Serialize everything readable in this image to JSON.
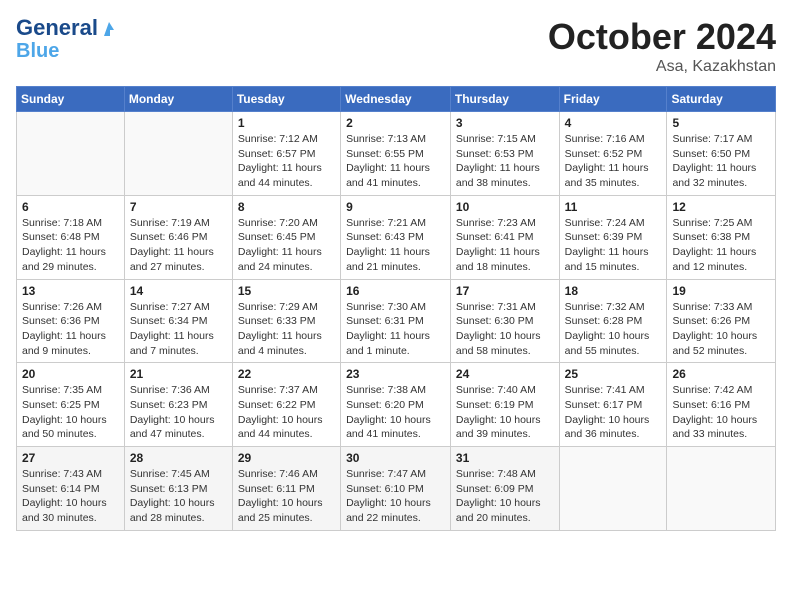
{
  "header": {
    "logo_line1": "General",
    "logo_line2": "Blue",
    "month": "October 2024",
    "location": "Asa, Kazakhstan"
  },
  "weekdays": [
    "Sunday",
    "Monday",
    "Tuesday",
    "Wednesday",
    "Thursday",
    "Friday",
    "Saturday"
  ],
  "weeks": [
    [
      {
        "day": "",
        "sunrise": "",
        "sunset": "",
        "daylight": ""
      },
      {
        "day": "",
        "sunrise": "",
        "sunset": "",
        "daylight": ""
      },
      {
        "day": "1",
        "sunrise": "Sunrise: 7:12 AM",
        "sunset": "Sunset: 6:57 PM",
        "daylight": "Daylight: 11 hours and 44 minutes."
      },
      {
        "day": "2",
        "sunrise": "Sunrise: 7:13 AM",
        "sunset": "Sunset: 6:55 PM",
        "daylight": "Daylight: 11 hours and 41 minutes."
      },
      {
        "day": "3",
        "sunrise": "Sunrise: 7:15 AM",
        "sunset": "Sunset: 6:53 PM",
        "daylight": "Daylight: 11 hours and 38 minutes."
      },
      {
        "day": "4",
        "sunrise": "Sunrise: 7:16 AM",
        "sunset": "Sunset: 6:52 PM",
        "daylight": "Daylight: 11 hours and 35 minutes."
      },
      {
        "day": "5",
        "sunrise": "Sunrise: 7:17 AM",
        "sunset": "Sunset: 6:50 PM",
        "daylight": "Daylight: 11 hours and 32 minutes."
      }
    ],
    [
      {
        "day": "6",
        "sunrise": "Sunrise: 7:18 AM",
        "sunset": "Sunset: 6:48 PM",
        "daylight": "Daylight: 11 hours and 29 minutes."
      },
      {
        "day": "7",
        "sunrise": "Sunrise: 7:19 AM",
        "sunset": "Sunset: 6:46 PM",
        "daylight": "Daylight: 11 hours and 27 minutes."
      },
      {
        "day": "8",
        "sunrise": "Sunrise: 7:20 AM",
        "sunset": "Sunset: 6:45 PM",
        "daylight": "Daylight: 11 hours and 24 minutes."
      },
      {
        "day": "9",
        "sunrise": "Sunrise: 7:21 AM",
        "sunset": "Sunset: 6:43 PM",
        "daylight": "Daylight: 11 hours and 21 minutes."
      },
      {
        "day": "10",
        "sunrise": "Sunrise: 7:23 AM",
        "sunset": "Sunset: 6:41 PM",
        "daylight": "Daylight: 11 hours and 18 minutes."
      },
      {
        "day": "11",
        "sunrise": "Sunrise: 7:24 AM",
        "sunset": "Sunset: 6:39 PM",
        "daylight": "Daylight: 11 hours and 15 minutes."
      },
      {
        "day": "12",
        "sunrise": "Sunrise: 7:25 AM",
        "sunset": "Sunset: 6:38 PM",
        "daylight": "Daylight: 11 hours and 12 minutes."
      }
    ],
    [
      {
        "day": "13",
        "sunrise": "Sunrise: 7:26 AM",
        "sunset": "Sunset: 6:36 PM",
        "daylight": "Daylight: 11 hours and 9 minutes."
      },
      {
        "day": "14",
        "sunrise": "Sunrise: 7:27 AM",
        "sunset": "Sunset: 6:34 PM",
        "daylight": "Daylight: 11 hours and 7 minutes."
      },
      {
        "day": "15",
        "sunrise": "Sunrise: 7:29 AM",
        "sunset": "Sunset: 6:33 PM",
        "daylight": "Daylight: 11 hours and 4 minutes."
      },
      {
        "day": "16",
        "sunrise": "Sunrise: 7:30 AM",
        "sunset": "Sunset: 6:31 PM",
        "daylight": "Daylight: 11 hours and 1 minute."
      },
      {
        "day": "17",
        "sunrise": "Sunrise: 7:31 AM",
        "sunset": "Sunset: 6:30 PM",
        "daylight": "Daylight: 10 hours and 58 minutes."
      },
      {
        "day": "18",
        "sunrise": "Sunrise: 7:32 AM",
        "sunset": "Sunset: 6:28 PM",
        "daylight": "Daylight: 10 hours and 55 minutes."
      },
      {
        "day": "19",
        "sunrise": "Sunrise: 7:33 AM",
        "sunset": "Sunset: 6:26 PM",
        "daylight": "Daylight: 10 hours and 52 minutes."
      }
    ],
    [
      {
        "day": "20",
        "sunrise": "Sunrise: 7:35 AM",
        "sunset": "Sunset: 6:25 PM",
        "daylight": "Daylight: 10 hours and 50 minutes."
      },
      {
        "day": "21",
        "sunrise": "Sunrise: 7:36 AM",
        "sunset": "Sunset: 6:23 PM",
        "daylight": "Daylight: 10 hours and 47 minutes."
      },
      {
        "day": "22",
        "sunrise": "Sunrise: 7:37 AM",
        "sunset": "Sunset: 6:22 PM",
        "daylight": "Daylight: 10 hours and 44 minutes."
      },
      {
        "day": "23",
        "sunrise": "Sunrise: 7:38 AM",
        "sunset": "Sunset: 6:20 PM",
        "daylight": "Daylight: 10 hours and 41 minutes."
      },
      {
        "day": "24",
        "sunrise": "Sunrise: 7:40 AM",
        "sunset": "Sunset: 6:19 PM",
        "daylight": "Daylight: 10 hours and 39 minutes."
      },
      {
        "day": "25",
        "sunrise": "Sunrise: 7:41 AM",
        "sunset": "Sunset: 6:17 PM",
        "daylight": "Daylight: 10 hours and 36 minutes."
      },
      {
        "day": "26",
        "sunrise": "Sunrise: 7:42 AM",
        "sunset": "Sunset: 6:16 PM",
        "daylight": "Daylight: 10 hours and 33 minutes."
      }
    ],
    [
      {
        "day": "27",
        "sunrise": "Sunrise: 7:43 AM",
        "sunset": "Sunset: 6:14 PM",
        "daylight": "Daylight: 10 hours and 30 minutes."
      },
      {
        "day": "28",
        "sunrise": "Sunrise: 7:45 AM",
        "sunset": "Sunset: 6:13 PM",
        "daylight": "Daylight: 10 hours and 28 minutes."
      },
      {
        "day": "29",
        "sunrise": "Sunrise: 7:46 AM",
        "sunset": "Sunset: 6:11 PM",
        "daylight": "Daylight: 10 hours and 25 minutes."
      },
      {
        "day": "30",
        "sunrise": "Sunrise: 7:47 AM",
        "sunset": "Sunset: 6:10 PM",
        "daylight": "Daylight: 10 hours and 22 minutes."
      },
      {
        "day": "31",
        "sunrise": "Sunrise: 7:48 AM",
        "sunset": "Sunset: 6:09 PM",
        "daylight": "Daylight: 10 hours and 20 minutes."
      },
      {
        "day": "",
        "sunrise": "",
        "sunset": "",
        "daylight": ""
      },
      {
        "day": "",
        "sunrise": "",
        "sunset": "",
        "daylight": ""
      }
    ]
  ]
}
